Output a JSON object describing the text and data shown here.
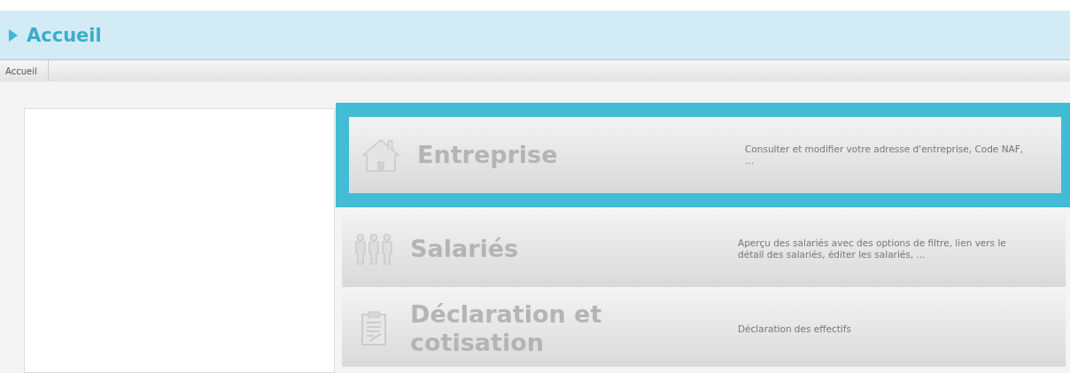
{
  "header": {
    "title": "Accueil"
  },
  "breadcrumb": [
    "Accueil"
  ],
  "menu": [
    {
      "kind": "house",
      "label": "Entreprise",
      "description": "Consulter et modifier votre adresse d'entreprise, Code NAF,\n...",
      "selected": true
    },
    {
      "kind": "people",
      "label": "Salariés",
      "description": "Aperçu des salariés avec des options de filtre, lien vers le\ndétail des salariés, éditer les salariés, ...",
      "selected": false
    },
    {
      "kind": "clipboard",
      "label": "Déclaration et\ncotisation",
      "description": "Déclaration des effectifs",
      "selected": false
    }
  ]
}
